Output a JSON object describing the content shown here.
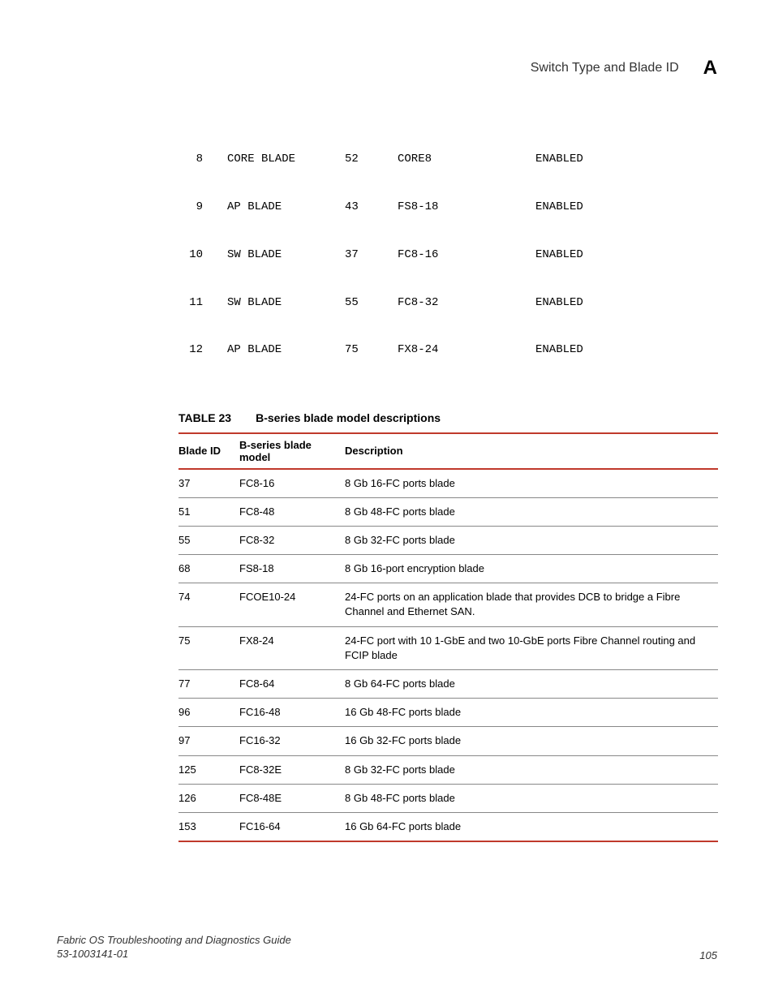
{
  "header": {
    "title": "Switch Type and Blade ID",
    "letter": "A"
  },
  "code_rows": [
    {
      "c1": "8",
      "c2": "CORE BLADE",
      "c3": "52",
      "c4": "CORE8",
      "c5": "ENABLED"
    },
    {
      "c1": "9",
      "c2": "AP BLADE",
      "c3": "43",
      "c4": "FS8-18",
      "c5": "ENABLED"
    },
    {
      "c1": "10",
      "c2": "SW BLADE",
      "c3": "37",
      "c4": "FC8-16",
      "c5": "ENABLED"
    },
    {
      "c1": "11",
      "c2": "SW BLADE",
      "c3": "55",
      "c4": "FC8-32",
      "c5": "ENABLED"
    },
    {
      "c1": "12",
      "c2": "AP BLADE",
      "c3": "75",
      "c4": "FX8-24",
      "c5": "ENABLED"
    }
  ],
  "table": {
    "label": "TABLE 23",
    "title": "B-series blade model descriptions",
    "headers": {
      "h1": "Blade ID",
      "h2": "B-series blade model",
      "h3": "Description"
    },
    "rows": [
      {
        "id": "37",
        "model": "FC8-16",
        "desc": "8 Gb 16-FC ports blade"
      },
      {
        "id": "51",
        "model": "FC8-48",
        "desc": "8 Gb 48-FC ports blade"
      },
      {
        "id": "55",
        "model": "FC8-32",
        "desc": "8 Gb 32-FC ports blade"
      },
      {
        "id": "68",
        "model": "FS8-18",
        "desc": "8 Gb 16-port encryption blade"
      },
      {
        "id": "74",
        "model": "FCOE10-24",
        "desc": "24-FC ports on an application blade that provides DCB to bridge a Fibre Channel and Ethernet SAN."
      },
      {
        "id": "75",
        "model": "FX8-24",
        "desc": "24-FC port with 10 1-GbE and two 10-GbE ports Fibre Channel routing and FCIP blade"
      },
      {
        "id": "77",
        "model": "FC8-64",
        "desc": "8 Gb 64-FC ports blade"
      },
      {
        "id": "96",
        "model": "FC16-48",
        "desc": "16 Gb 48-FC ports blade"
      },
      {
        "id": "97",
        "model": "FC16-32",
        "desc": "16 Gb 32-FC ports blade"
      },
      {
        "id": "125",
        "model": "FC8-32E",
        "desc": "8 Gb 32-FC ports blade"
      },
      {
        "id": "126",
        "model": "FC8-48E",
        "desc": "8 Gb 48-FC ports blade"
      },
      {
        "id": "153",
        "model": "FC16-64",
        "desc": "16 Gb 64-FC ports blade"
      }
    ]
  },
  "footer": {
    "guide": "Fabric OS Troubleshooting and Diagnostics Guide",
    "docnum": "53-1003141-01",
    "page": "105"
  }
}
